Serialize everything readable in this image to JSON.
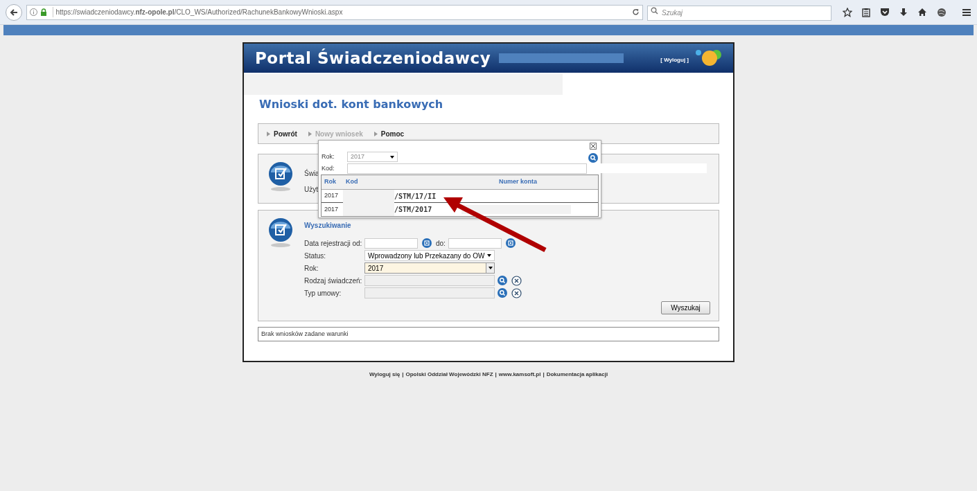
{
  "browser": {
    "url": "https://swiadczeniodawcy.**nfz-opole.pl**/CLO_WS/Authorized/RachunekBankowyWnioski.aspx",
    "search_placeholder": "Szukaj"
  },
  "header": {
    "title": "Portal Świadczeniodawcy",
    "logout": "[ Wyloguj ]"
  },
  "page_title": "Wnioski dot. kont bankowych",
  "menu": [
    {
      "label": "Powrót",
      "disabled": false
    },
    {
      "label": "Nowy wniosek",
      "disabled": true
    },
    {
      "label": "Pomoc",
      "disabled": false
    }
  ],
  "info_panel": {
    "lines": [
      "Świa",
      "Użyt"
    ]
  },
  "search_panel": {
    "title": "Wyszukiwanie",
    "fields": [
      {
        "kind": "daterange",
        "label": "Data rejestracji od:",
        "to_label": "do:"
      },
      {
        "kind": "select",
        "label": "Status:",
        "value": "Wprowadzony lub Przekazany do OW",
        "highlighted": false
      },
      {
        "kind": "select",
        "label": "Rok:",
        "value": "2017",
        "highlighted": true
      },
      {
        "kind": "lookup",
        "label": "Rodzaj świadczeń:"
      },
      {
        "kind": "lookup",
        "label": "Typ umowy:"
      }
    ],
    "button": "Wyszukaj"
  },
  "result_message": "Brak wniosków zadane warunki",
  "footer_separator": "|",
  "footer": [
    "Wyloguj się",
    "Opolski Oddział Wojewódzki NFZ",
    "www.kamsoft.pl",
    "Dokumentacja aplikacji"
  ],
  "popup": {
    "year_label": "Rok:",
    "year_value": "2017",
    "code_label": "Kod:",
    "columns": [
      "Rok",
      "Kod",
      "Numer konta"
    ],
    "rows": [
      {
        "rok": "2017",
        "numer": "/STM/17/II"
      },
      {
        "rok": "2017",
        "numer": "/STM/2017"
      }
    ]
  }
}
